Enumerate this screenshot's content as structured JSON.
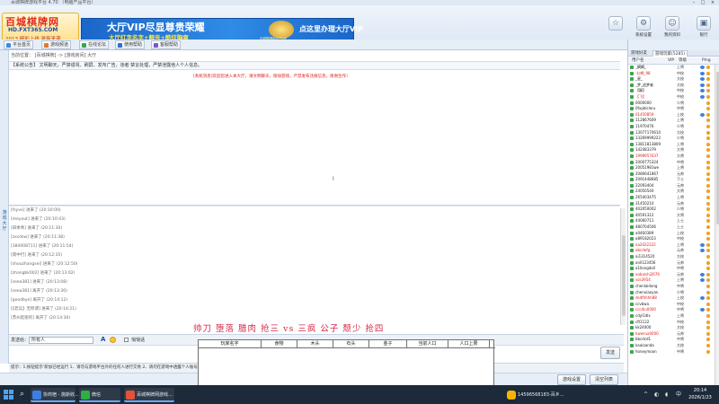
{
  "window": {
    "title": "百城棋牌游戏平台 4.70 （电脑产品平台）"
  },
  "logo": {
    "line1": "百城棋牌网",
    "line2": "HD.FXT365.COM",
    "line3": "2013 精彩上线 激爽来袭"
  },
  "vip_banner": {
    "line1": "大厅VIP尽显尊贵荣耀",
    "line2": "大厅红字名字+靓号+酷炫胸章",
    "emblem_caption": "百城棋牌网大厅VIP",
    "line3": "点这里办理大厅VIP"
  },
  "system_buttons": [
    {
      "label": "",
      "icon": "star-icon"
    },
    {
      "label": "系统设置",
      "icon": "gear-icon"
    },
    {
      "label": "我的资料",
      "icon": "user-icon"
    },
    {
      "label": "银行",
      "icon": "bank-icon"
    },
    {
      "label": "返回大厅",
      "icon": "exit-icon"
    }
  ],
  "nav_tabs": [
    {
      "label": "平台首页",
      "color": "#3f8ae0"
    },
    {
      "label": "游戏频道",
      "color": "#e07a2a"
    },
    {
      "label": "在线论坛",
      "color": "#3fa34d"
    },
    {
      "label": "使用帮助",
      "color": "#2f6fd0"
    },
    {
      "label": "客服帮助",
      "color": "#7a58c8"
    }
  ],
  "chat": {
    "location_bar": "当前位置：  [百城棋牌]  ->  [游戏房间]  大厅",
    "notice": "【系统公告】  文明聊天，严禁谩骂、刷屏、发布广告，违者  禁言处理，严禁泄露他人个人信息。",
    "welcome": "[系统消息]欢迎您进入本大厅，请文明聊天，愉快游戏，严禁发布违规信息，谢谢合作！",
    "messages": [
      "[fsyvo] 进来了 (20:10:00)",
      "[meyout] 进来了 (20:10:43)",
      "[四季青] 进来了 (20:11:30)",
      "[zxcdsw] 进来了 (20:11:38)",
      "[384008711] 进来了 (20:11:54)",
      "[雨中行] 进来了 (20:12:35)",
      "[shouzhangsei] 进来了 (20:12:50)",
      "[zhangbk002] 进来了 (20:13:02)",
      "[seea381] 进来了 (20:13:08)",
      "[seea381] 离开了 (20:13:30)",
      "[goodbye] 离开了 (20:14:12)",
      "[【老兵】无所谓] 进来了 (20:14:21)",
      "[苏州逛街的] 离开了 (20:14:30)"
    ]
  },
  "player_names": "帅刀 堕落 腊肉 抢三 vs 三疯 公子 颓少 抢四",
  "input_bar": {
    "label": "发送给：",
    "target_value": "所有人",
    "font_icon_text": "A",
    "checkbox_label": "悄悄话"
  },
  "send_button": "发送",
  "tip_text": "提示：1.按钮提示‘新加已经运行  1、请勿与游戏平台外的任何人进行交易   2、请勿在游戏中透露个人账号信息",
  "bottom_buttons": [
    "游戏设置",
    "清空列表"
  ],
  "result_table": {
    "headers": [
      "玩家名字",
      "食物",
      "木头",
      "石头",
      "金子",
      "当前人口",
      "人口上限"
    ]
  },
  "right_panel": {
    "tabs": [
      "游戏好友",
      "游戏玩家(5285)"
    ],
    "columns": [
      "用户名",
      "VIP",
      "等级",
      "Ping"
    ],
    "users": [
      {
        "name": "_蝎蝎_",
        "level": "上将",
        "vip": true,
        "red": false
      },
      {
        "name": "-幻想_98",
        "level": "中校",
        "vip": true,
        "red": true
      },
      {
        "name": "_星_",
        "level": "大校",
        "vip": true,
        "red": false
      },
      {
        "name": "_梦_追梦者",
        "level": "大校",
        "vip": true,
        "red": false
      },
      {
        "name": "【飘】",
        "level": "中校",
        "vip": true,
        "red": false
      },
      {
        "name": "【飞】",
        "level": "中校",
        "vip": true,
        "red": true
      },
      {
        "name": "0000000",
        "level": "少将",
        "vip": false,
        "red": false
      },
      {
        "name": "0fxpblcleru",
        "level": "中将",
        "vip": false,
        "red": false
      },
      {
        "name": "01450859",
        "level": "上校",
        "vip": true,
        "red": true
      },
      {
        "name": "112867609",
        "level": "上将",
        "vip": false,
        "red": false
      },
      {
        "name": "11970476",
        "level": "少将",
        "vip": false,
        "red": false
      },
      {
        "name": "13077170610",
        "level": "大校",
        "vip": false,
        "red": false
      },
      {
        "name": "13269999222",
        "level": "少将",
        "vip": false,
        "red": false
      },
      {
        "name": "13811813809",
        "level": "上将",
        "vip": false,
        "red": false
      },
      {
        "name": "142483379",
        "level": "大将",
        "vip": false,
        "red": false
      },
      {
        "name": "1999957637",
        "level": "大将",
        "vip": false,
        "red": true
      },
      {
        "name": "2000775324",
        "level": "中将",
        "vip": false,
        "red": false
      },
      {
        "name": "20051981we",
        "level": "上将",
        "vip": false,
        "red": false
      },
      {
        "name": "2080641867",
        "level": "元帅",
        "vip": false,
        "red": false
      },
      {
        "name": "2091448685",
        "level": "下士",
        "vip": false,
        "red": false
      },
      {
        "name": "22093404",
        "level": "元帅",
        "vip": false,
        "red": false
      },
      {
        "name": "24050540",
        "level": "大将",
        "vip": false,
        "red": false
      },
      {
        "name": "265403475",
        "level": "上将",
        "vip": false,
        "red": false
      },
      {
        "name": "31450210",
        "level": "元帅",
        "vip": false,
        "red": false
      },
      {
        "name": "402050002",
        "level": "少将",
        "vip": false,
        "red": false
      },
      {
        "name": "40591312",
        "level": "大将",
        "vip": false,
        "red": false
      },
      {
        "name": "44060711",
        "level": "上士",
        "vip": false,
        "red": false
      },
      {
        "name": "480704506",
        "level": "上士",
        "vip": false,
        "red": false
      },
      {
        "name": "a0460389",
        "level": "上校",
        "vip": false,
        "red": false
      },
      {
        "name": "a89182023",
        "level": "中校",
        "vip": false,
        "red": false
      },
      {
        "name": "aa2022222",
        "level": "上将",
        "vip": true,
        "red": true
      },
      {
        "name": "abcdefg",
        "level": "元帅",
        "vip": true,
        "red": true
      },
      {
        "name": "ai1314520",
        "level": "大校",
        "vip": false,
        "red": false
      },
      {
        "name": "anll123456",
        "level": "元帅",
        "vip": false,
        "red": false
      },
      {
        "name": "a1llongdall",
        "level": "中将",
        "vip": false,
        "red": false
      },
      {
        "name": "aobaishi2676",
        "level": "元帅",
        "vip": true,
        "red": true
      },
      {
        "name": "sos3954",
        "level": "上将",
        "vip": true,
        "red": true
      },
      {
        "name": "chenlaidong",
        "level": "中将",
        "vip": false,
        "red": false
      },
      {
        "name": "chenxiaoyan",
        "level": "少将",
        "vip": false,
        "red": false
      },
      {
        "name": "dsdfhhhh88",
        "level": "上校",
        "vip": true,
        "red": true
      },
      {
        "name": "ccvbwa",
        "level": "中校",
        "vip": false,
        "red": false
      },
      {
        "name": "cccdiu0000",
        "level": "中将",
        "vip": true,
        "red": true
      },
      {
        "name": "cdyl1dlx",
        "level": "上将",
        "vip": false,
        "red": false
      },
      {
        "name": "cft1122",
        "level": "中校",
        "vip": false,
        "red": false
      },
      {
        "name": "kk24000",
        "level": "大校",
        "vip": false,
        "red": false
      },
      {
        "name": "kwwrua0000",
        "level": "元帅",
        "vip": false,
        "red": true
      },
      {
        "name": "bbcdcd1",
        "level": "中将",
        "vip": false,
        "red": false
      },
      {
        "name": "kaaiaanda",
        "level": "大校",
        "vip": false,
        "red": false
      },
      {
        "name": "honeymoon",
        "level": "中将",
        "vip": false,
        "red": false
      }
    ]
  },
  "taskbar": {
    "apps": [
      {
        "label": "协商宿 - 施斯收...",
        "color": "#3d7ee0"
      },
      {
        "label": "微信",
        "color": "#2fae44"
      },
      {
        "label": "百城棋牌网游戏...",
        "color": "#e0533a"
      }
    ],
    "notify": "14596568183-百乡...",
    "time": "20:14",
    "date": "2026/1/23"
  }
}
